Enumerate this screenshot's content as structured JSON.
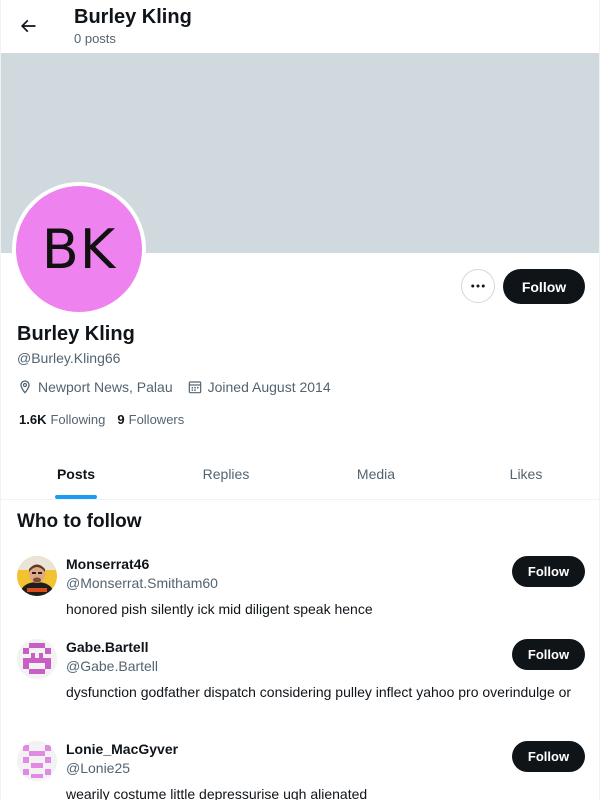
{
  "header": {
    "title": "Burley Kling",
    "post_count": "0 posts"
  },
  "profile": {
    "avatar_initials": "BK",
    "avatar_color": "#ee82ee",
    "banner_color": "#cfd9de",
    "name": "Burley Kling",
    "handle": "@Burley.Kling66",
    "location": "Newport News, Palau",
    "joined": "Joined August 2014",
    "following_count": "1.6K",
    "following_label": "Following",
    "followers_count": "9",
    "followers_label": "Followers",
    "follow_label": "Follow"
  },
  "tabs": [
    {
      "label": "Posts",
      "active": true
    },
    {
      "label": "Replies",
      "active": false
    },
    {
      "label": "Media",
      "active": false
    },
    {
      "label": "Likes",
      "active": false
    }
  ],
  "who_to_follow": {
    "title": "Who to follow",
    "items": [
      {
        "name": "Monserrat46",
        "handle": "@Monserrat.Smitham60",
        "bio": "honored pish silently ick mid diligent speak hence",
        "follow_label": "Follow",
        "avatar": "photo-avatar"
      },
      {
        "name": "Gabe.Bartell",
        "handle": "@Gabe.Bartell",
        "bio": "dysfunction godfather dispatch considering pulley inflect yahoo pro overindulge or",
        "follow_label": "Follow",
        "avatar": "pixel-avatar"
      },
      {
        "name": "Lonie_MacGyver",
        "handle": "@Lonie25",
        "bio": "wearily costume little depressurise ugh alienated",
        "follow_label": "Follow",
        "avatar": "pixel-avatar"
      }
    ]
  },
  "colors": {
    "accent": "#1d9bf0",
    "button_dark": "#0f1419",
    "secondary_text": "#536471"
  }
}
